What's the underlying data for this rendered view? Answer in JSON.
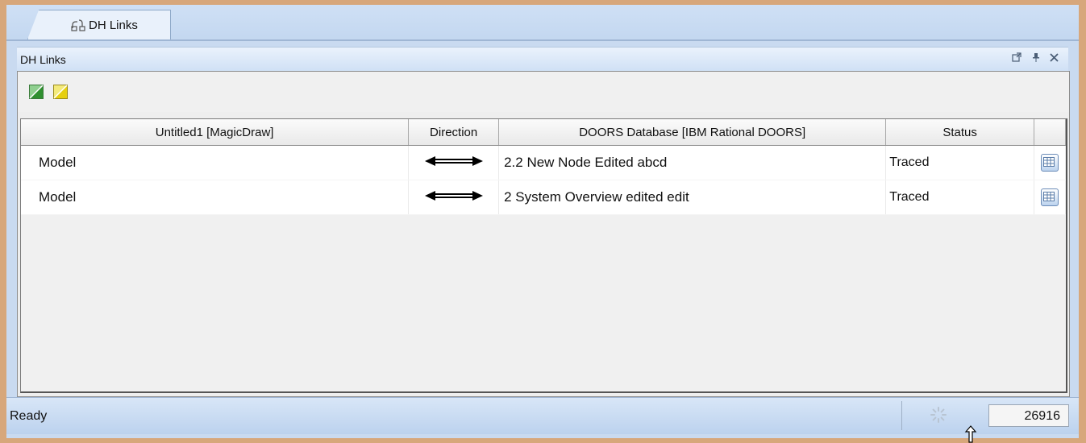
{
  "tab": {
    "label": "DH Links",
    "icon": "links-icon"
  },
  "panel": {
    "title": "DH Links",
    "header_buttons": [
      {
        "name": "undock-icon",
        "glyph": "⇱"
      },
      {
        "name": "pin-icon",
        "glyph": "ᛘ"
      },
      {
        "name": "close-icon",
        "glyph": "✕"
      }
    ]
  },
  "toolbar": {
    "buttons": [
      {
        "name": "green-link-icon",
        "color": "#3aa63a"
      },
      {
        "name": "yellow-link-icon",
        "color": "#e6d21a"
      }
    ]
  },
  "table": {
    "columns": [
      "Untitled1 [MagicDraw]",
      "Direction",
      "DOORS Database [IBM Rational DOORS]",
      "Status",
      ""
    ],
    "rows": [
      {
        "source": "Model",
        "direction": "bidirectional-arrow",
        "target": "2.2 New Node Edited abcd",
        "status": "Traced"
      },
      {
        "source": "Model",
        "direction": "bidirectional-arrow",
        "target": "2 System Overview edited edit",
        "status": "Traced"
      }
    ]
  },
  "statusbar": {
    "text": "Ready",
    "counter": "26916"
  }
}
